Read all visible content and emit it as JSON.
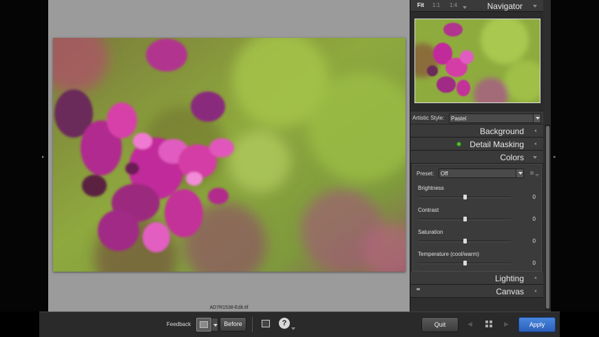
{
  "canvas": {
    "filename": "AD7R1538-Edit.tif"
  },
  "navigator": {
    "title": "Navigator",
    "zoom_options": [
      "Fit",
      "1:1",
      "1:4"
    ],
    "active_zoom": "Fit"
  },
  "artistic_style": {
    "label": "Artistic Style:",
    "value": "Pastel"
  },
  "sections": {
    "background": "Background",
    "detail_masking": "Detail Masking",
    "colors": "Colors",
    "lighting": "Lighting",
    "canvas": "Canvas"
  },
  "colors_panel": {
    "preset_label": "Preset:",
    "preset_value": "Off",
    "sliders": [
      {
        "label": "Brightness",
        "value": "0",
        "level": 0.5
      },
      {
        "label": "Contrast",
        "value": "0",
        "level": 0.5
      },
      {
        "label": "Saturation",
        "value": "0",
        "level": 0.5
      },
      {
        "label": "Temperature (cool/warm)",
        "value": "0",
        "level": 0.5
      }
    ]
  },
  "toolbar": {
    "feedback_label": "Feedback",
    "before_label": "Before",
    "help_glyph": "?",
    "quit_label": "Quit",
    "apply_label": "Apply"
  },
  "colors": {
    "accent": "#3a74d0",
    "status_on": "#4fc12f"
  },
  "icons": [
    "chevron-left-icon",
    "chevron-down-icon",
    "status-dot-icon",
    "image-icon",
    "help-icon",
    "grid-icon",
    "arrow-left-icon",
    "arrow-right-icon"
  ]
}
